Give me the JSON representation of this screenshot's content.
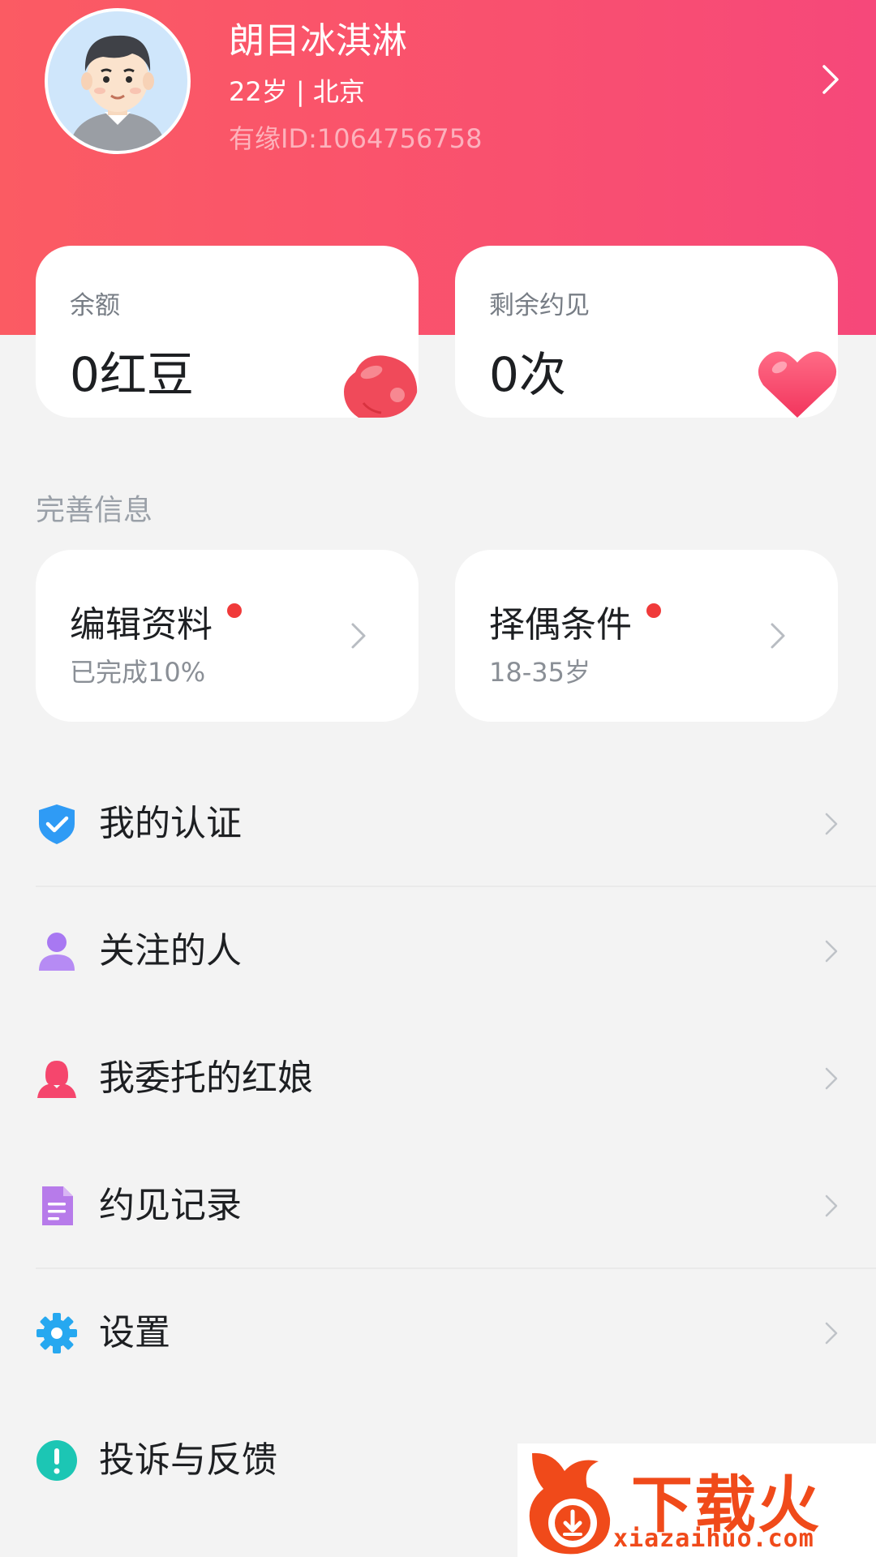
{
  "profile": {
    "name": "朗目冰淇淋",
    "meta": "22岁 | 北京",
    "id_text": "有缘ID:1064756758"
  },
  "stats": [
    {
      "label": "余额",
      "value": "0红豆",
      "icon": "red-bean-icon"
    },
    {
      "label": "剩余约见",
      "value": "0次",
      "icon": "heart-icon"
    }
  ],
  "section_title": "完善信息",
  "info_cards": [
    {
      "title": "编辑资料",
      "sub": "已完成10%"
    },
    {
      "title": "择偶条件",
      "sub": "18-35岁"
    }
  ],
  "menu": [
    {
      "label": "我的认证",
      "icon": "verified-shield-icon",
      "color": "#2f9bf5"
    },
    {
      "label": "关注的人",
      "icon": "person-icon",
      "color": "#a878f2"
    },
    {
      "label": "我委托的红娘",
      "icon": "matchmaker-icon",
      "color": "#f5466d"
    },
    {
      "label": "约见记录",
      "icon": "document-icon",
      "color": "#b77bea"
    },
    {
      "label": "设置",
      "icon": "gear-icon",
      "color": "#26a8f0"
    },
    {
      "label": "投诉与反馈",
      "icon": "exclamation-icon",
      "color": "#1cc6b4"
    }
  ],
  "watermark": {
    "brand": "下载火",
    "url": "xiazaihuo.com"
  },
  "colors": {
    "header_gradient_start": "#fb5b63",
    "header_gradient_end": "#f6487a",
    "background": "#f3f3f3",
    "red_dot": "#f03a3a"
  }
}
